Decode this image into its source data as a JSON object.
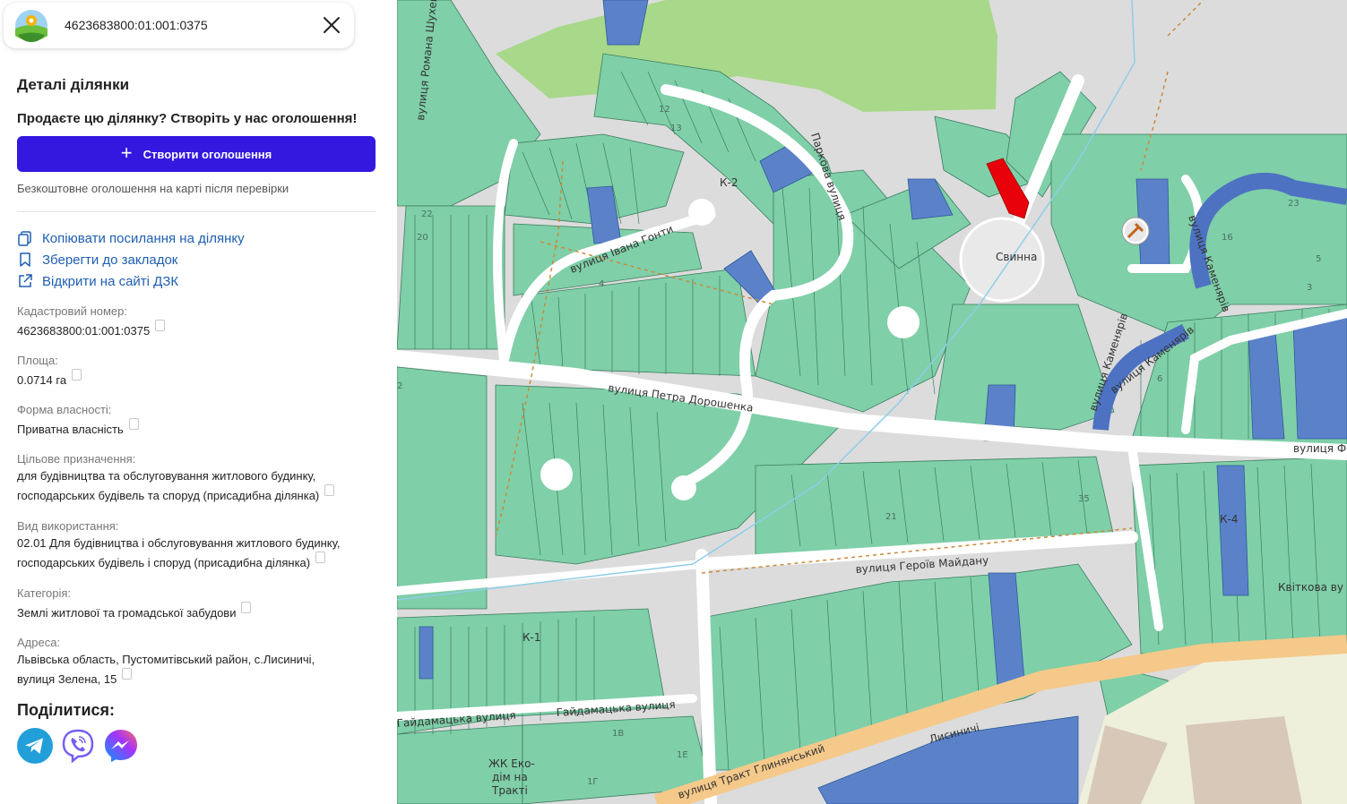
{
  "search": {
    "value": "4623683800:01:001:0375"
  },
  "panel": {
    "title": "Деталі ділянки",
    "promo": "Продаєте цю ділянку? Створіть у нас оголошення!",
    "create_button": "Створити оголошення",
    "free_note": "Безкоштовне оголошення на карті після перевірки",
    "actions": {
      "copy_link": "Копіювати посилання на ділянку",
      "bookmark": "Зберегти до закладок",
      "open_dzk": "Відкрити на сайті ДЗК"
    },
    "fields": {
      "cadastral": {
        "label": "Кадастровий номер:",
        "value": "4623683800:01:001:0375"
      },
      "area": {
        "label": "Площа:",
        "value": "0.0714 га"
      },
      "ownership": {
        "label": "Форма власності:",
        "value": "Приватна власність"
      },
      "purpose": {
        "label": "Цільове призначення:",
        "line1": "для будівництва та обслуговування житлового будинку,",
        "line2": "господарських будівель та споруд (присадибна ділянка)"
      },
      "usage": {
        "label": "Вид використання:",
        "line1": "02.01 Для будівництва і обслуговування житлового будинку,",
        "line2": "господарських будівель і споруд (присадибна ділянка)"
      },
      "category": {
        "label": "Категорія:",
        "value": "Землі житлової та громадської забудови"
      },
      "address": {
        "label": "Адреса:",
        "line1": "Львівська область, Пустомитівський район, с.Лисиничі,",
        "line2": "вулиця Зелена, 15"
      }
    },
    "share": {
      "title": "Поділитися:",
      "services": [
        "telegram-icon",
        "viber-icon",
        "messenger-icon"
      ]
    }
  },
  "map": {
    "place_label": "Свинна",
    "streets": {
      "r_shukhevych": "вулиця Романа Шухев",
      "parkova": "Паркова вулиця",
      "gonty": "вулиця Івана Гонти",
      "doroshenko": "вулиця Петра Дорошенка",
      "heroiv": "вулиця Героїв Майдану",
      "haidamatska": "Гайдамацька вулиця",
      "haidamatska2": "Гайдамацька вулиця",
      "kameniariv": "вулиця Каменярів",
      "kameniariv2": "вулиця Каменярів",
      "kamenia_v": "вулиця Каменярів",
      "tract": "вулиця Тракт Глинянський",
      "kvitkova": "Квіткова ву",
      "vulytsia_right": "вулиця Ф"
    },
    "blocks": {
      "k1": "К-1",
      "k2": "К-2",
      "k4": "К-4"
    },
    "numbers": [
      "12",
      "13",
      "16",
      "3",
      "4",
      "5",
      "6",
      "35",
      "21",
      "22",
      "23",
      "20",
      "2",
      "1В",
      "1Г",
      "1Е"
    ],
    "area_label": "Лисиничі",
    "complex_label": [
      "ЖК Еко-",
      "дім на",
      "Тракті"
    ],
    "colors": {
      "parcel": "#7fcfa8",
      "parcel_blue": "#5b82c9",
      "selected": "#e8000b",
      "road": "#ffffff",
      "forest": "#a8d88a",
      "highway": "#f5c98a"
    }
  }
}
